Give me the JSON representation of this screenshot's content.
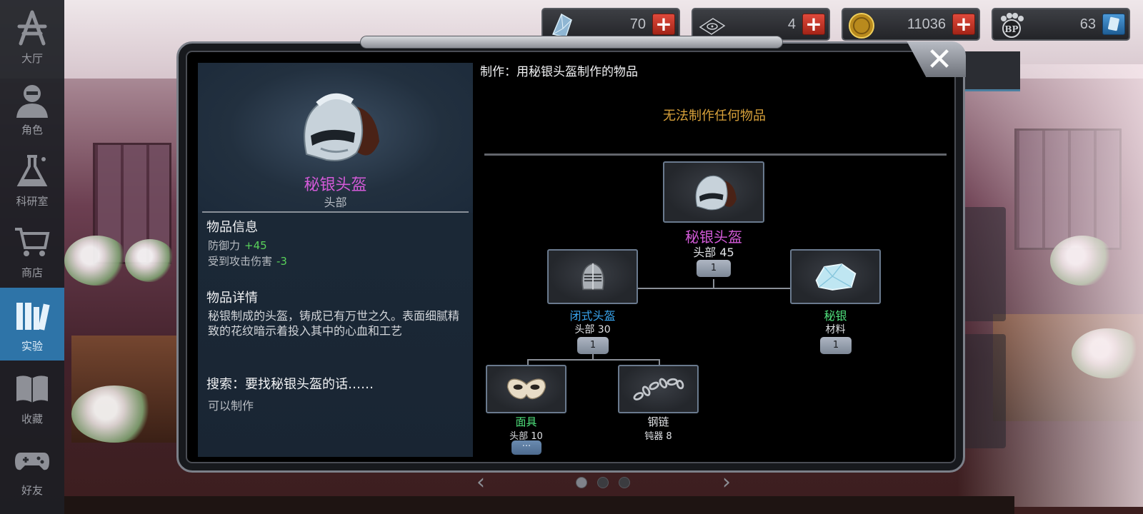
{
  "sidebar": {
    "items": [
      {
        "label": "大厅",
        "icon": "lobby-icon"
      },
      {
        "label": "角色",
        "icon": "character-icon"
      },
      {
        "label": "科研室",
        "icon": "flask-icon"
      },
      {
        "label": "商店",
        "icon": "cart-icon"
      },
      {
        "label": "实验",
        "icon": "books-icon",
        "active": true
      },
      {
        "label": "收藏",
        "icon": "book-icon"
      },
      {
        "label": "好友",
        "icon": "gamepad-icon"
      }
    ]
  },
  "currency": [
    {
      "name": "crystal",
      "icon": "crystal-icon",
      "value": "70",
      "button": "+"
    },
    {
      "name": "disk",
      "icon": "disk-icon",
      "value": "4",
      "button": "+"
    },
    {
      "name": "gold",
      "icon": "coin-icon",
      "value": "11036",
      "button": "+"
    },
    {
      "name": "bp",
      "icon": "bp-paw-icon",
      "value": "63",
      "button": "card"
    }
  ],
  "item": {
    "name": "秘银头盔",
    "slot": "头部",
    "info_heading": "物品信息",
    "stats": [
      {
        "label": "防御力",
        "value": "+45"
      },
      {
        "label": "受到攻击伤害",
        "value": "-3"
      }
    ],
    "details_heading": "物品详情",
    "details": "秘银制成的头盔，铸成已有万世之久。表面细腻精致的花纹暗示着投入其中的心血和工艺",
    "search_heading": "搜索：要找秘银头盔的话……",
    "search_text": "可以制作"
  },
  "craft": {
    "title": "制作：用秘银头盔制作的物品",
    "empty_message": "无法制作任何物品",
    "tree": {
      "root": {
        "name": "秘银头盔",
        "sub": "头部 45",
        "qty": "1"
      },
      "left": {
        "name": "闭式头盔",
        "sub": "头部 30",
        "qty": "1"
      },
      "right": {
        "name": "秘银",
        "sub": "材料",
        "qty": "1"
      },
      "left_left": {
        "name": "面具",
        "sub": "头部 10",
        "qty": "···"
      },
      "left_right": {
        "name": "钢链",
        "sub": "钝器 8"
      }
    }
  },
  "colors": {
    "rare_purple": "#d35ad8",
    "blue_name": "#3aa6f0",
    "green_name": "#4fe07c",
    "warning_gold": "#d8a13a",
    "stat_green": "#59d25a",
    "active_tab": "#2e74a8"
  },
  "close_label": "✕",
  "pager": {
    "prev": "‹",
    "next": "›",
    "pages": 3,
    "current": 1
  }
}
